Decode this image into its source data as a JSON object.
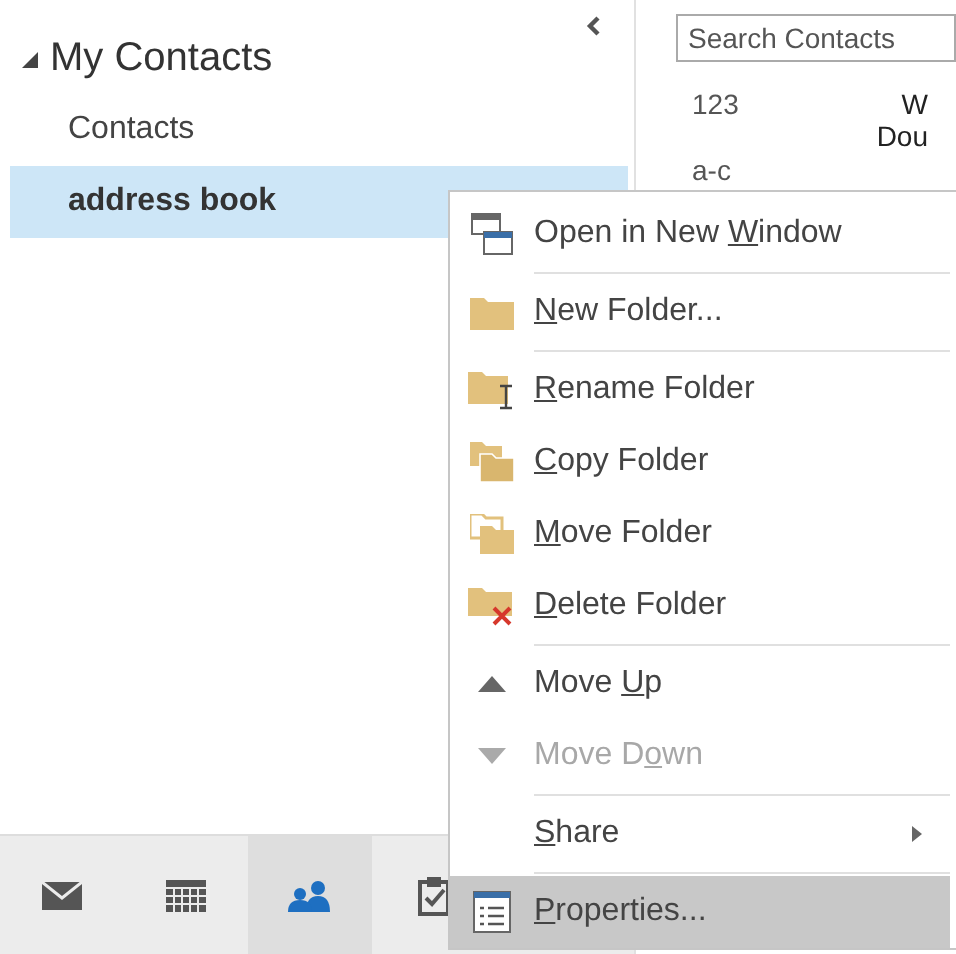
{
  "folder_pane": {
    "group": {
      "label": "My Contacts",
      "expanded": true
    },
    "folders": [
      {
        "label": "Contacts",
        "selected": false
      },
      {
        "label": "address book",
        "selected": true
      }
    ]
  },
  "search": {
    "placeholder": "Search Contacts"
  },
  "index": [
    "123",
    "a-c"
  ],
  "contact_cut": [
    "W",
    "Dou"
  ],
  "nav": [
    {
      "kind": "mail",
      "selected": false
    },
    {
      "kind": "calendar",
      "selected": false
    },
    {
      "kind": "people",
      "selected": true
    },
    {
      "kind": "tasks",
      "selected": false
    }
  ],
  "context_menu": [
    {
      "kind": "window",
      "before": "Open in New ",
      "key": "W",
      "after": "indow",
      "disabled": false,
      "selected": false,
      "submenu": false,
      "separator_after": true
    },
    {
      "kind": "folder",
      "key": "N",
      "after": "ew Folder...",
      "disabled": false,
      "selected": false,
      "submenu": false,
      "separator_after": true
    },
    {
      "kind": "rename",
      "key": "R",
      "after": "ename Folder",
      "disabled": false,
      "selected": false,
      "submenu": false,
      "separator_after": false
    },
    {
      "kind": "copy",
      "key": "C",
      "after": "opy Folder",
      "disabled": false,
      "selected": false,
      "submenu": false,
      "separator_after": false
    },
    {
      "kind": "move",
      "key": "M",
      "after": "ove Folder",
      "disabled": false,
      "selected": false,
      "submenu": false,
      "separator_after": false
    },
    {
      "kind": "delete",
      "key": "D",
      "after": "elete Folder",
      "disabled": false,
      "selected": false,
      "submenu": false,
      "separator_after": true
    },
    {
      "kind": "up",
      "before": "Move ",
      "key": "U",
      "after": "p",
      "disabled": false,
      "selected": false,
      "submenu": false,
      "separator_after": false
    },
    {
      "kind": "down",
      "before": "Move D",
      "key": "o",
      "after": "wn",
      "disabled": true,
      "selected": false,
      "submenu": false,
      "separator_after": true
    },
    {
      "kind": "plain",
      "key": "S",
      "after": "hare",
      "disabled": false,
      "selected": false,
      "submenu": true,
      "separator_after": true
    },
    {
      "kind": "properties",
      "key": "P",
      "after": "roperties...",
      "disabled": false,
      "selected": true,
      "submenu": false,
      "separator_after": false
    }
  ]
}
